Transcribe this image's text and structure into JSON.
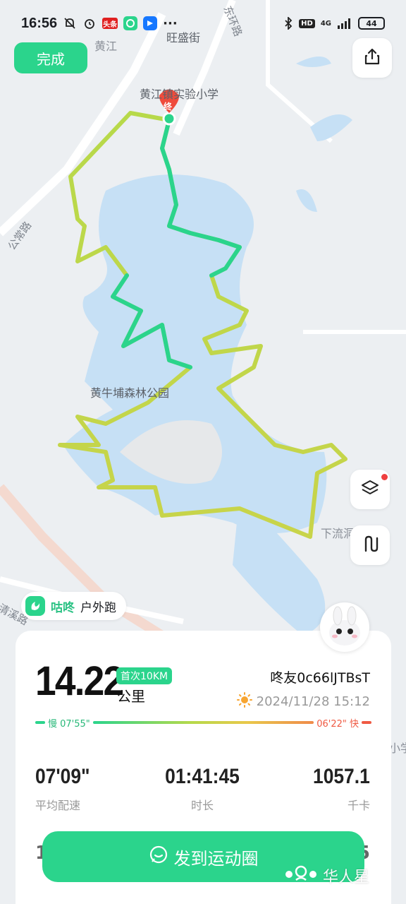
{
  "status_bar": {
    "time": "16:56",
    "app_icon_label": "头条",
    "network": "4G",
    "hd": "HD",
    "battery": "44"
  },
  "top": {
    "done_label": "完成",
    "share_icon": "share-icon"
  },
  "map": {
    "labels": {
      "road_north": "东环路",
      "street": "旺盛街",
      "town": "黄江",
      "school": "黄江镇实验小学",
      "road_west": "公常路",
      "park": "黄牛埔森林公园",
      "place_east": "下流洞",
      "road_sw": "清溪路",
      "edge": "小学"
    },
    "end_marker": "终",
    "route_colors": [
      "#2bd48c",
      "#b7d94a",
      "#e9c84a"
    ]
  },
  "brand": {
    "name": "咕咚",
    "sub": "户外跑"
  },
  "card": {
    "distance": "14.22",
    "badge": "首次10KM",
    "unit": "公里",
    "user": "咚友0c66lJTBsT",
    "date": "2024/11/28 15:12",
    "pace_slow": "慢 07'55\"",
    "pace_fast": "06'22\" 快",
    "stats": [
      {
        "value": "07'09\"",
        "label": "平均配速"
      },
      {
        "value": "01:41:45",
        "label": "时长"
      },
      {
        "value": "1057.1",
        "label": "千卡"
      }
    ],
    "peek_left": "1",
    "peek_right": "5"
  },
  "actions": {
    "post_label": "发到运动圈"
  },
  "watermark": {
    "text": "华人星"
  }
}
